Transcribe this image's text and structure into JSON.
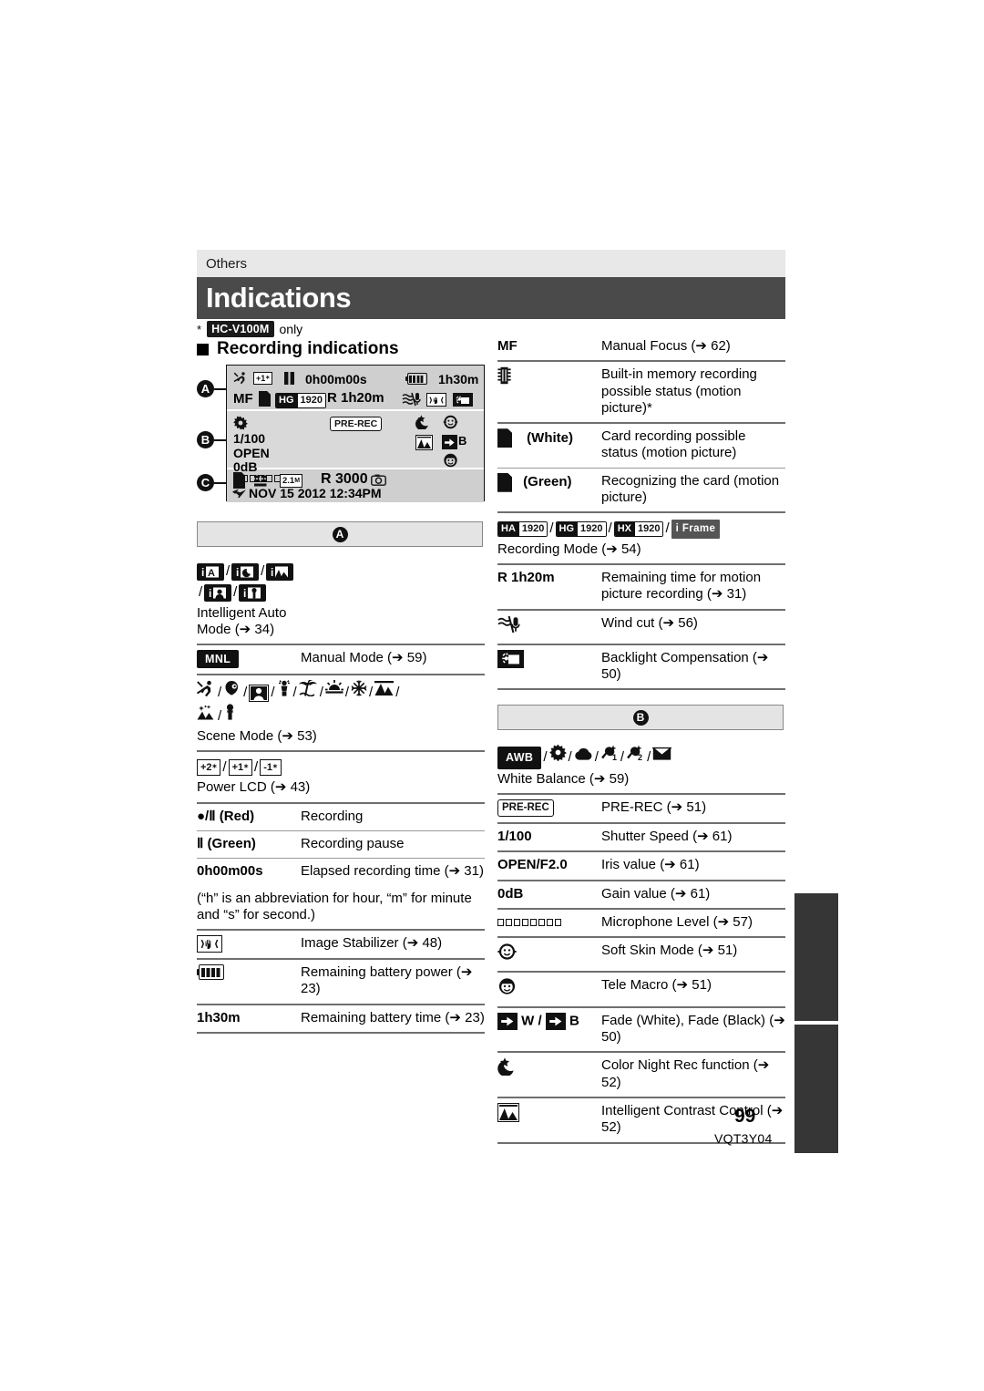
{
  "page": {
    "chapter": "Others",
    "title": "Indications",
    "footnote_asterisk": "*",
    "footnote_model": "HC-V100M",
    "footnote_only": "only",
    "section_heading": "Recording indications",
    "page_number": "99",
    "doc_code": "VQT3Y04"
  },
  "lcd": {
    "marker_a": "A",
    "marker_b": "B",
    "marker_c": "C",
    "row_a": {
      "scene_icon": "scene-sports-icon",
      "power_lcd": "+1",
      "pause_icon": "pause-icon",
      "elapsed": "0h00m00s",
      "battery_icon": "battery-icon",
      "battery_time": "1h30m",
      "mf": "MF",
      "card_icon": "sd-card-icon",
      "rec_mode_left": "HG",
      "rec_mode_right": "1920",
      "remaining": "R 1h20m",
      "wind_cut_icon": "wind-cut-icon",
      "stabilizer_icon": "image-stabilizer-icon",
      "backlight_icon": "backlight-compensation-icon"
    },
    "row_b": {
      "wb_icon": "white-balance-icon",
      "prerec": "PRE-REC",
      "shutter": "1/100",
      "iris": "OPEN",
      "gain": "0dB",
      "mic_level_icon": "microphone-level-icon",
      "night_icon": "color-night-rec-icon",
      "soft_skin_icon": "soft-skin-icon",
      "contrast_icon": "intelligent-contrast-icon",
      "fade_label": "B",
      "tele_macro_icon": "tele-macro-icon"
    },
    "row_c": {
      "card_icon": "sd-card-icon",
      "quality_icon": "picture-quality-icon",
      "size": "2.1",
      "size_unit": "M",
      "remaining_photos": "R 3000",
      "photo_icon": "camera-icon",
      "travel_icon": "world-time-icon",
      "datetime": "NOV 15 2012 12:34PM"
    }
  },
  "left_column": {
    "band_label": "A",
    "rows": [
      {
        "type": "icons",
        "icons": [
          "iA",
          "i-night",
          "i-scenery",
          "i-portrait",
          "i-macro"
        ],
        "caption": "Intelligent Auto Mode (➔ 34)"
      },
      {
        "type": "kv",
        "chip": "MNL",
        "value": "Manual Mode (➔ 59)"
      },
      {
        "type": "icons",
        "icons": [
          "sports",
          "portrait",
          "soft-skin",
          "spotlight",
          "beach",
          "sunset",
          "snow",
          "scenery",
          "fireworks",
          "night-scenery"
        ],
        "caption": "Scene Mode (➔ 53)"
      },
      {
        "type": "icons",
        "icons": [
          "+2",
          "+1",
          "-1"
        ],
        "caption": "Power LCD (➔ 43)"
      },
      {
        "type": "kv",
        "key": "●/Ⅱ (Red)",
        "value": "Recording"
      },
      {
        "type": "kv",
        "key": "Ⅱ (Green)",
        "value": "Recording pause"
      },
      {
        "type": "kv",
        "key": "0h00m00s",
        "value": "Elapsed recording time (➔ 31)"
      },
      {
        "type": "note",
        "text": "(“h” is an abbreviation for hour, “m” for minute and “s” for second.)"
      },
      {
        "type": "kv",
        "key_icon": "image-stabilizer-icon",
        "value": "Image Stabilizer (➔ 48)"
      },
      {
        "type": "kv",
        "key_icon": "battery-icon",
        "value": "Remaining battery power (➔ 23)"
      },
      {
        "type": "kv",
        "key": "1h30m",
        "value": "Remaining battery time (➔ 23)"
      }
    ]
  },
  "right_column": {
    "band_label": "B",
    "top_rows": [
      {
        "type": "kv",
        "key": "MF",
        "value": "Manual Focus (➔ 62)"
      },
      {
        "type": "kv",
        "key_icon": "built-in-memory-icon",
        "value": "Built-in memory recording possible status (motion picture)*"
      },
      {
        "type": "kv",
        "key_icon": "sd-card-icon",
        "key_label": "(White)",
        "value": "Card recording possible status (motion picture)"
      },
      {
        "type": "kv",
        "key_icon": "sd-card-icon",
        "key_label": "(Green)",
        "value": "Recognizing the card (motion picture)"
      },
      {
        "type": "icons",
        "chips": [
          {
            "left": "HA",
            "right": "1920"
          },
          {
            "left": "HG",
            "right": "1920"
          },
          {
            "left": "HX",
            "right": "1920"
          }
        ],
        "iframe": "i Frame",
        "caption": "Recording Mode (➔ 54)"
      },
      {
        "type": "kv",
        "key": "R 1h20m",
        "value": "Remaining time for motion picture recording (➔ 31)"
      },
      {
        "type": "kv",
        "key_icon": "wind-cut-icon",
        "value": "Wind cut (➔ 56)"
      },
      {
        "type": "kv",
        "key_icon": "backlight-compensation-icon",
        "value": "Backlight Compensation (➔ 50)"
      }
    ],
    "bottom_rows": [
      {
        "type": "icons",
        "chip": "AWB",
        "icons": [
          "sun",
          "cloud",
          "halogen1",
          "halogen2",
          "manual-wb"
        ],
        "caption": "White Balance (➔ 59)"
      },
      {
        "type": "kv",
        "key_chip": "PRE-REC",
        "value": "PRE-REC (➔ 51)"
      },
      {
        "type": "kv",
        "key": "1/100",
        "value": "Shutter Speed (➔ 61)"
      },
      {
        "type": "kv",
        "key": "OPEN/F2.0",
        "value": "Iris value (➔ 61)"
      },
      {
        "type": "kv",
        "key": "0dB",
        "value": "Gain value (➔ 61)"
      },
      {
        "type": "kv",
        "key_icon": "microphone-level-icon",
        "value": "Microphone Level (➔ 57)"
      },
      {
        "type": "kv",
        "key_icon": "soft-skin-icon",
        "value": "Soft Skin Mode (➔ 51)"
      },
      {
        "type": "kv",
        "key_icon": "tele-macro-icon",
        "value": "Tele Macro (➔ 51)"
      },
      {
        "type": "kv",
        "key_icon": "fade-icon",
        "key_label": "W / B",
        "value": "Fade (White), Fade (Black) (➔ 50)"
      },
      {
        "type": "kv",
        "key_icon": "color-night-rec-icon",
        "value": "Color Night Rec function (➔ 52)"
      },
      {
        "type": "kv",
        "key_icon": "intelligent-contrast-icon",
        "value": "Intelligent Contrast Control (➔ 52)"
      }
    ]
  }
}
